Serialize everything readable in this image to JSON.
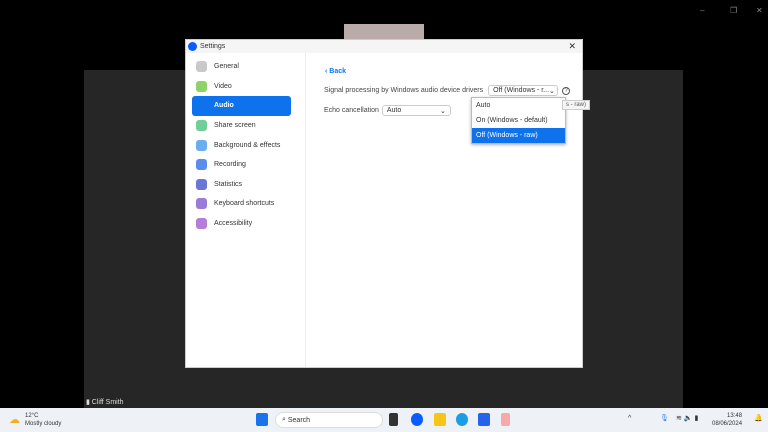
{
  "window": {
    "title": "Settings",
    "close": "✕"
  },
  "participant": {
    "name": "Cliff Smith"
  },
  "sidebar": {
    "items": [
      {
        "label": "General",
        "color": "#c9c9c9"
      },
      {
        "label": "Video",
        "color": "#8fd26a"
      },
      {
        "label": "Audio",
        "color": "#0e72ed"
      },
      {
        "label": "Share screen",
        "color": "#6fcf97"
      },
      {
        "label": "Background & effects",
        "color": "#6aaef0"
      },
      {
        "label": "Recording",
        "color": "#5b8def"
      },
      {
        "label": "Statistics",
        "color": "#6b77d6"
      },
      {
        "label": "Keyboard shortcuts",
        "color": "#9a7bd6"
      },
      {
        "label": "Accessibility",
        "color": "#b57ed6"
      }
    ],
    "active": "Audio"
  },
  "main": {
    "back": "Back",
    "signal_label": "Signal processing by Windows audio device drivers",
    "signal_value": "Off (Windows - r...",
    "echo_label": "Echo cancellation",
    "echo_value": "Auto",
    "options": [
      "Auto",
      "On (Windows - default)",
      "Off (Windows - raw)"
    ],
    "selected": "Off (Windows - raw)",
    "tooltip": "s - raw)"
  },
  "taskbar": {
    "temp": "12°C",
    "weather": "Mostly cloudy",
    "search": "Search",
    "time": "13:48",
    "date": "08/06/2024"
  }
}
